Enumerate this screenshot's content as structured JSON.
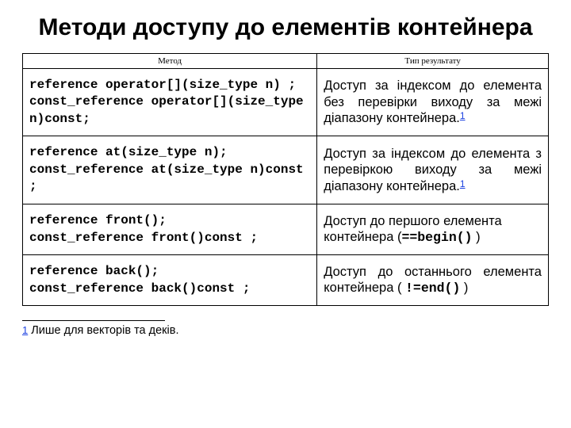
{
  "title": "Методи доступу до елементів контейнера",
  "headers": {
    "method": "Метод",
    "result": "Тип результату"
  },
  "rows": [
    {
      "method": "reference operator[](size_type n) ;\nconst_reference operator[](size_type n)const;",
      "result_a": "Доступ за індексом до елемента без перевірки виходу за межі діапазону контейнера.",
      "sup": "1"
    },
    {
      "method": "reference at(size_type n);\nconst_reference at(size_type n)const ;",
      "result_a": "Доступ за індексом до елемента з перевіркою виходу за межі діапазону контейнера.",
      "sup": "1"
    },
    {
      "method": "reference front();\nconst_reference front()const ;",
      "result_a": "Доступ до першого елемента контейнера (",
      "code": "==begin()",
      "result_b": " )"
    },
    {
      "method": "reference back();\nconst_reference back()const ;",
      "result_a": "Доступ до останнього елемента контейнера ( ",
      "code": "!=end()",
      "result_b": " )"
    }
  ],
  "footnote": {
    "num": "1",
    "text": " Лише для векторів та деків."
  }
}
